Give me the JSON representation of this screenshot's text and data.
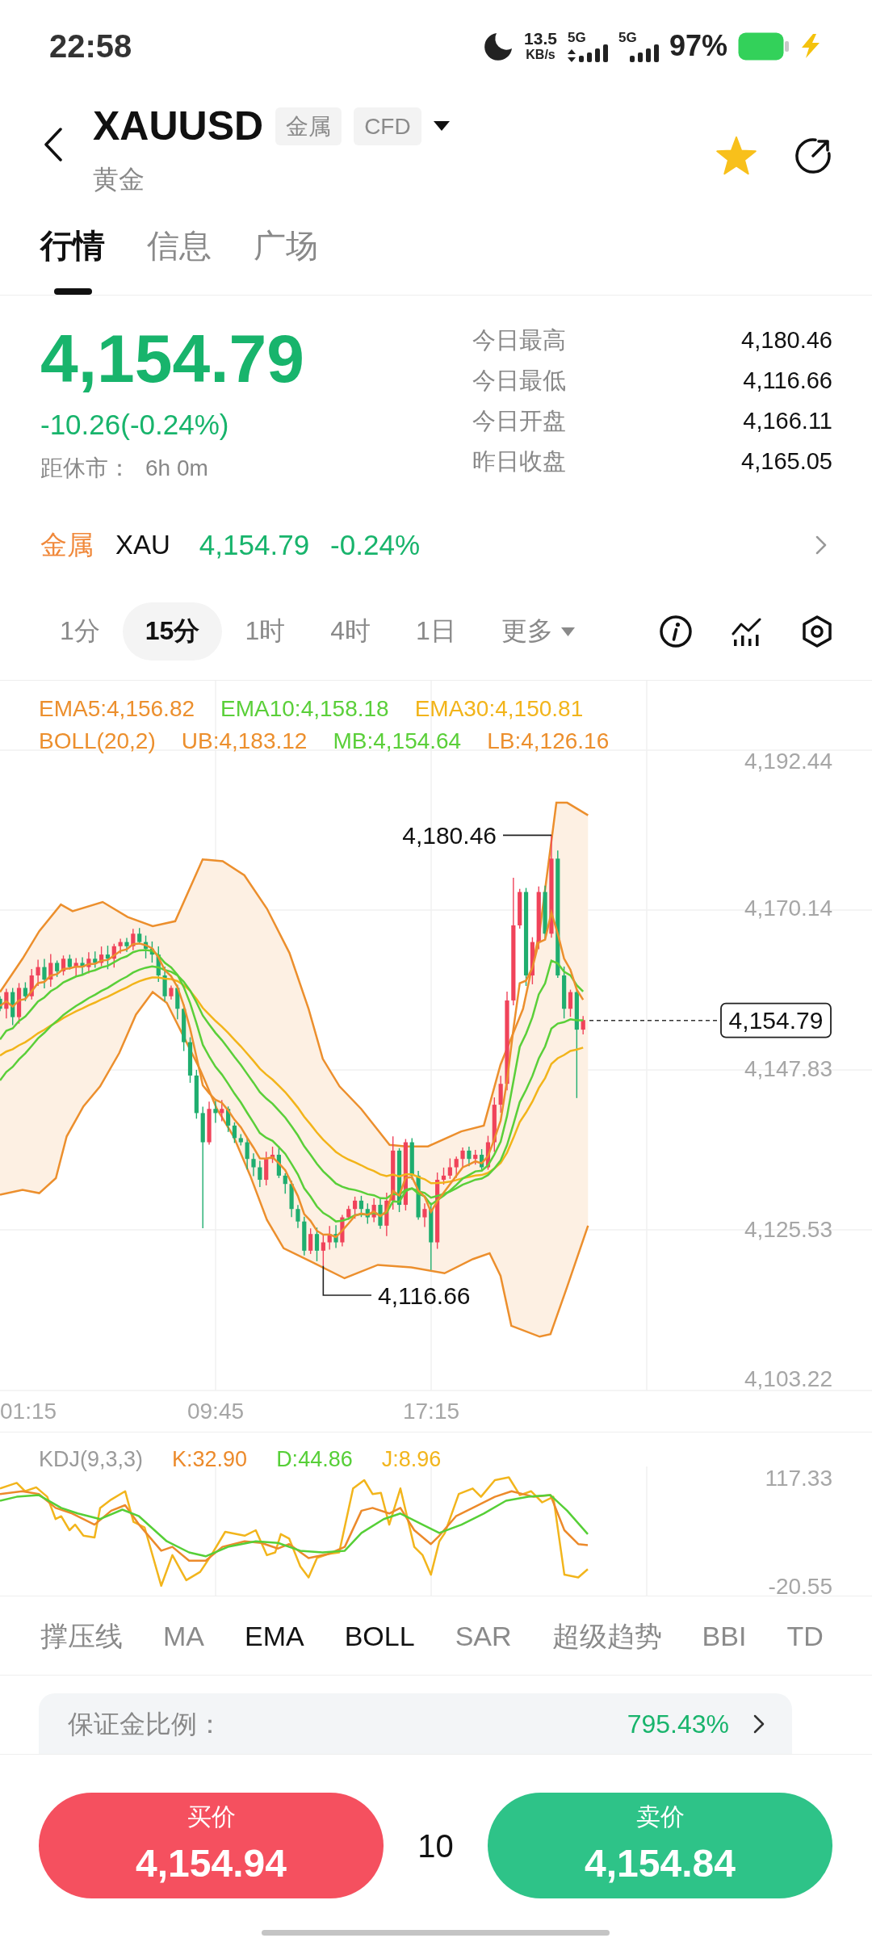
{
  "status_bar": {
    "time": "22:58",
    "network_speed": {
      "value": "13.5",
      "unit": "KB/s"
    },
    "networks": [
      {
        "label": "5G",
        "active_data": true
      },
      {
        "label": "5G",
        "active_data": false
      }
    ],
    "battery": "97%"
  },
  "header": {
    "symbol": "XAUUSD",
    "tags": [
      "金属",
      "CFD"
    ],
    "name": "黄金",
    "favorited": true
  },
  "tabs": [
    {
      "label": "行情",
      "selected": true
    },
    {
      "label": "信息",
      "selected": false
    },
    {
      "label": "广场",
      "selected": false
    }
  ],
  "quote": {
    "price": "4,154.79",
    "change": "-10.26(-0.24%)",
    "close_label": "距休市：",
    "close_time": "6h 0m",
    "stats": [
      {
        "label": "今日最高",
        "value": "4,180.46"
      },
      {
        "label": "今日最低",
        "value": "4,116.66"
      },
      {
        "label": "今日开盘",
        "value": "4,166.11"
      },
      {
        "label": "昨日收盘",
        "value": "4,165.05"
      }
    ]
  },
  "ticker": {
    "category": "金属",
    "symbol": "XAU",
    "price": "4,154.79",
    "change": "-0.24%"
  },
  "timeframes": [
    {
      "label": "1分",
      "kind": "interval",
      "selected": false
    },
    {
      "label": "15分",
      "kind": "interval",
      "selected": true
    },
    {
      "label": "1时",
      "kind": "interval",
      "selected": false
    },
    {
      "label": "4时",
      "kind": "interval",
      "selected": false
    },
    {
      "label": "1日",
      "kind": "interval",
      "selected": false
    },
    {
      "label": "更多",
      "kind": "dropdown",
      "selected": false
    }
  ],
  "chart": {
    "legend_rows": [
      [
        {
          "text": "EMA5:4,156.82",
          "color": "#ec8f2d"
        },
        {
          "text": "EMA10:4,158.18",
          "color": "#5acf39"
        },
        {
          "text": "EMA30:4,150.81",
          "color": "#f2b41a"
        }
      ],
      [
        {
          "text": "BOLL(20,2)",
          "color": "#ec8f2d"
        },
        {
          "text": "UB:4,183.12",
          "color": "#ec8f2d"
        },
        {
          "text": "MB:4,154.64",
          "color": "#5acf39"
        },
        {
          "text": "LB:4,126.16",
          "color": "#ec8f2d"
        }
      ]
    ],
    "y_axis": [
      "4,192.44",
      "4,170.14",
      "4,147.83",
      "4,125.53",
      "4,103.22"
    ],
    "x_axis": [
      "01:15",
      "09:45",
      "17:15"
    ],
    "high_label": "4,180.46",
    "low_label": "4,116.66",
    "last_price": "4,154.79"
  },
  "kdj": {
    "legend": [
      {
        "text": "KDJ(9,3,3)",
        "color": "#9a9a9a"
      },
      {
        "text": "K:32.90",
        "color": "#ec8a2b"
      },
      {
        "text": "D:44.86",
        "color": "#56cf37"
      },
      {
        "text": "J:8.96",
        "color": "#f2b51c"
      }
    ],
    "y_axis": [
      "117.33",
      "-20.55"
    ]
  },
  "indicators": [
    {
      "label": "撑压线",
      "selected": false
    },
    {
      "label": "MA",
      "selected": false
    },
    {
      "label": "EMA",
      "selected": true
    },
    {
      "label": "BOLL",
      "selected": true
    },
    {
      "label": "SAR",
      "selected": false
    },
    {
      "label": "超级趋势",
      "selected": false
    },
    {
      "label": "BBI",
      "selected": false
    },
    {
      "label": "TD",
      "selected": false
    }
  ],
  "margin_card": {
    "label": "保证金比例：",
    "value": "795.43%"
  },
  "trade_bar": {
    "buy": {
      "label": "买价",
      "price": "4,154.94"
    },
    "quantity": "10",
    "sell": {
      "label": "卖价",
      "price": "4,154.84"
    }
  }
}
